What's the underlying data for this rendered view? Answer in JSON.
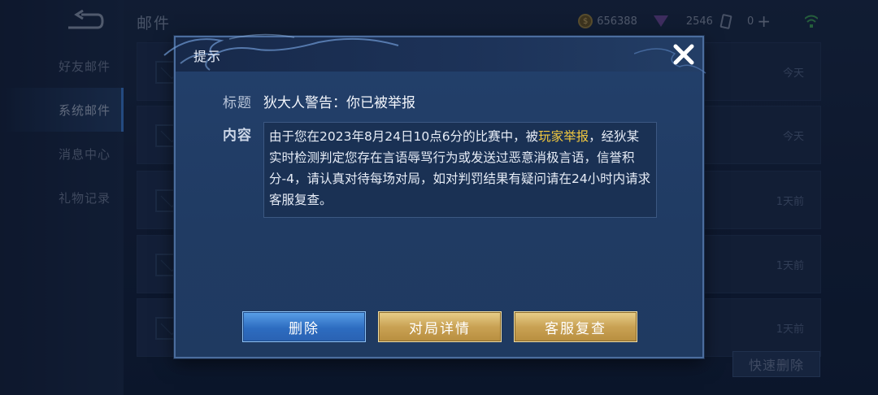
{
  "background": {
    "page_title": "邮件",
    "nav": [
      {
        "label": "好友邮件"
      },
      {
        "label": "系统邮件"
      },
      {
        "label": "消息中心"
      },
      {
        "label": "礼物记录"
      }
    ],
    "resources": {
      "coins": "656388",
      "gems": "2546",
      "cards": "0"
    },
    "mail_times": [
      "今天",
      "今天",
      "1天前",
      "1天前",
      "1天前"
    ],
    "quick_delete_label": "快速删除"
  },
  "dialog": {
    "title": "提示",
    "subject_label": "标题",
    "subject": "狄大人警告：你已被举报",
    "content_label": "内容",
    "content": {
      "before": "由于您在2023年8月24日10点6分的比赛中，被",
      "highlight": "玩家举报",
      "after": "，经狄某实时检测判定您存在言语辱骂行为或发送过恶意消极言语，信誉积分-4，请认真对待每场对局，如对判罚结果有疑问请在24小时内请求客服复查。"
    },
    "buttons": {
      "delete": "删除",
      "match_details": "对局详情",
      "support_review": "客服复查"
    }
  },
  "colors": {
    "highlight": "#f3c93e",
    "primary_button": "#2d6cc0",
    "gold_button": "#c9a254"
  }
}
